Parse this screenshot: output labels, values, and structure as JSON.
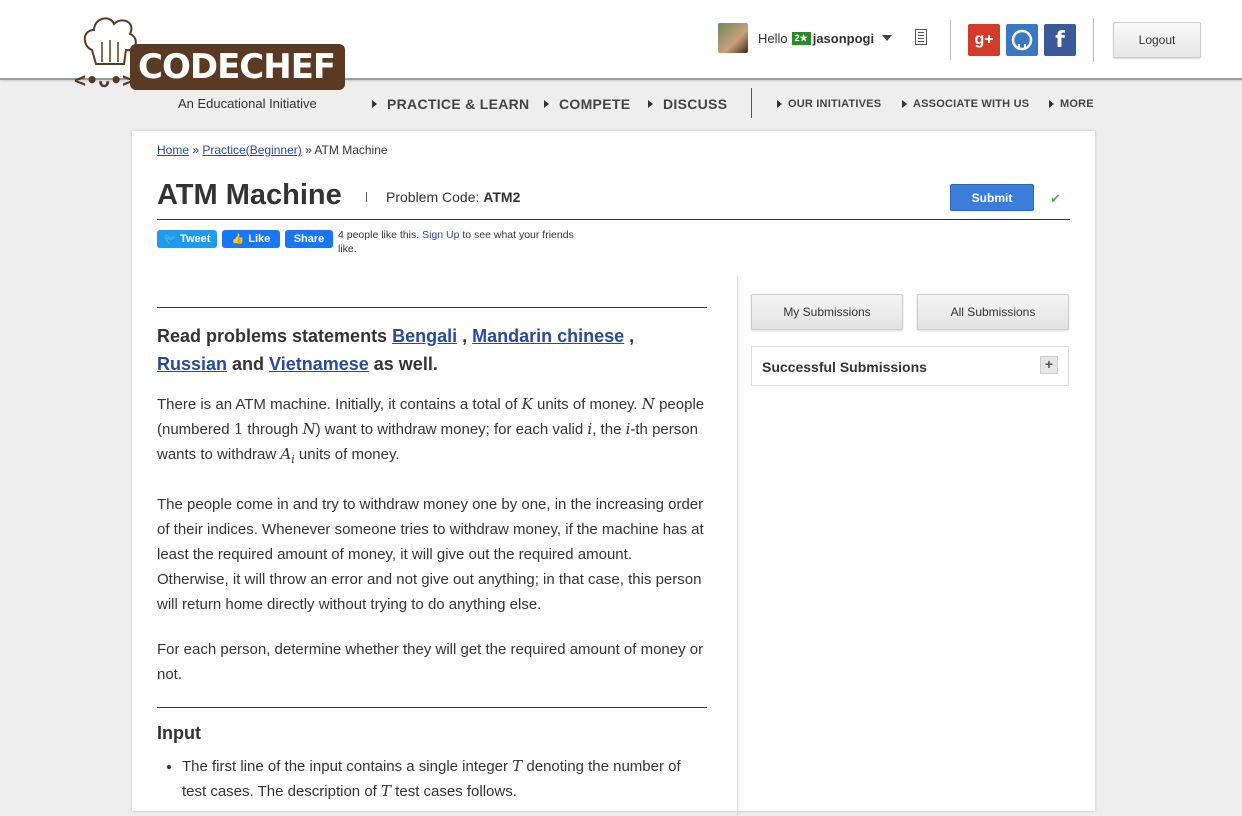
{
  "header": {
    "logo_text": "CODECHEF",
    "tagline": "An Educational Initiative",
    "greeting": "Hello",
    "user_rating_badge": "2★",
    "username": "jasonpogi",
    "logout_label": "Logout",
    "social": [
      {
        "name": "google-plus",
        "glyph": "g+",
        "color": "#d23b2a"
      },
      {
        "name": "github",
        "glyph": "◯",
        "color": "#3a78c2"
      },
      {
        "name": "facebook",
        "glyph": "f",
        "color": "#3b5998"
      }
    ]
  },
  "nav": {
    "primary": [
      "PRACTICE & LEARN",
      "COMPETE",
      "DISCUSS"
    ],
    "secondary": [
      "OUR INITIATIVES",
      "ASSOCIATE WITH US",
      "MORE"
    ]
  },
  "breadcrumb": {
    "home": "Home",
    "sep1": " » ",
    "practice": "Practice(Beginner)",
    "sep2": " » ",
    "current": "ATM Machine"
  },
  "problem": {
    "title": "ATM Machine",
    "code_label": "Problem Code: ",
    "code": "ATM2",
    "submit_label": "Submit",
    "check": "✔"
  },
  "share": {
    "tweet": "Tweet",
    "like": "Like",
    "share": "Share",
    "likes_text": "4 people like this. ",
    "signup": "Sign Up",
    "likes_tail": " to see what your friends like."
  },
  "statement": {
    "read_prefix": "Read problems statements ",
    "languages": [
      "Bengali",
      "Mandarin chinese",
      "Russian",
      "Vietnamese"
    ],
    "comma": " , ",
    "and": " and ",
    "read_suffix": " as well.",
    "p1": {
      "a": "There is an ATM machine. Initially, it contains a total of ",
      "K": "K",
      "b": " units of money. ",
      "N": "N",
      "c": " people (numbered ",
      "one": "1",
      "d": " through ",
      "N2": "N",
      "e": ") want to withdraw money; for each valid ",
      "i": "i",
      "f": ", the ",
      "i2": "i",
      "g": "-th person wants to withdraw ",
      "A": "A",
      "sub": "i",
      "h": " units of money."
    },
    "p2": "The people come in and try to withdraw money one by one, in the increasing order of their indices. Whenever someone tries to withdraw money, if the machine has at least the required amount of money, it will give out the required amount. Otherwise, it will throw an error and not give out anything; in that case, this person will return home directly without trying to do anything else.",
    "p3": "For each person, determine whether they will get the required amount of money or not.",
    "input_heading": "Input",
    "input_item1": {
      "a": "The first line of the input contains a single integer ",
      "T": "T",
      "b": " denoting the number of test cases. The description of ",
      "T2": "T",
      "c": " test cases follows."
    }
  },
  "sidebar": {
    "my_submissions": "My Submissions",
    "all_submissions": "All Submissions",
    "successful": "Successful Submissions",
    "plus": "+"
  }
}
